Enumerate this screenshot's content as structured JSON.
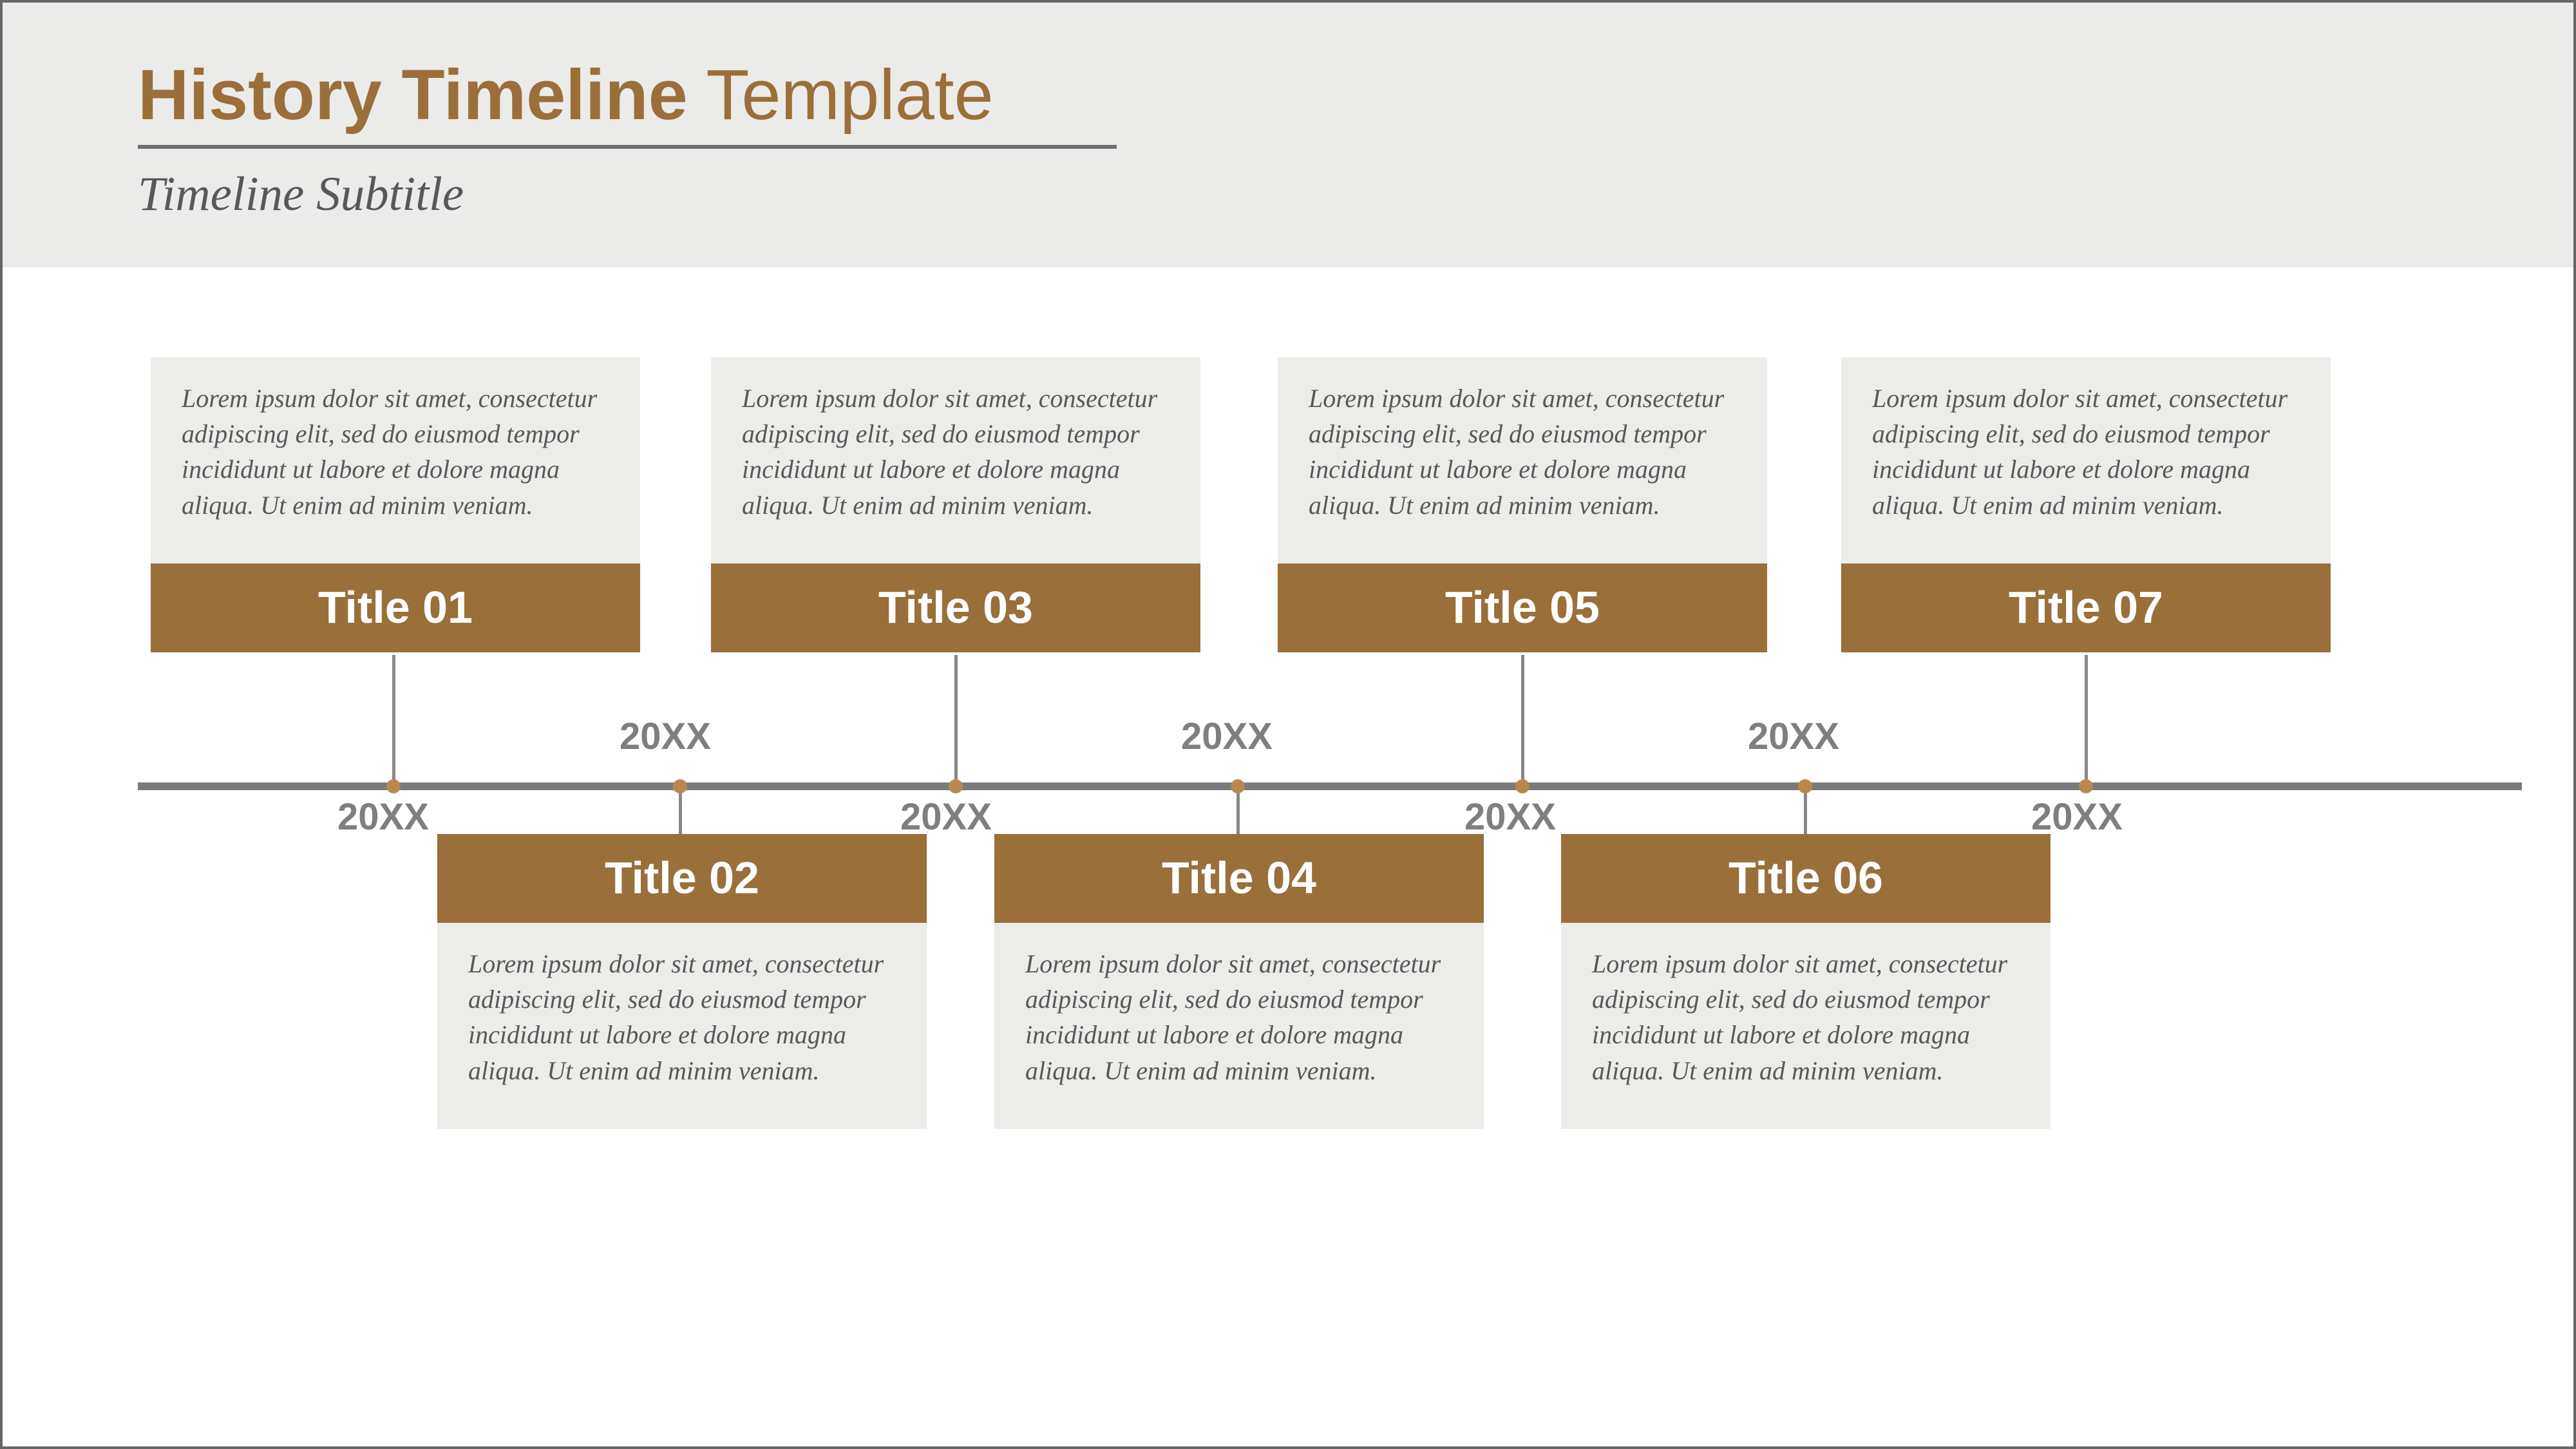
{
  "header": {
    "title_bold": "History Timeline",
    "title_light": " Template",
    "subtitle": "Timeline Subtitle"
  },
  "lorem": "Lorem ipsum dolor sit amet, consectetur adipiscing elit, sed do eiusmod tempor incididunt ut labore et dolore magna aliqua. Ut enim ad minim veniam.",
  "events": [
    {
      "title": "Title 01",
      "year": "20XX",
      "pos": "top"
    },
    {
      "title": "Title 02",
      "year": "20XX",
      "pos": "bottom"
    },
    {
      "title": "Title 03",
      "year": "20XX",
      "pos": "top"
    },
    {
      "title": "Title 04",
      "year": "20XX",
      "pos": "bottom"
    },
    {
      "title": "Title 05",
      "year": "20XX",
      "pos": "top"
    },
    {
      "title": "Title 06",
      "year": "20XX",
      "pos": "bottom"
    },
    {
      "title": "Title 07",
      "year": "20XX",
      "pos": "top"
    }
  ],
  "colors": {
    "accent": "#9a6f3a",
    "bg_light": "#ecece9"
  }
}
